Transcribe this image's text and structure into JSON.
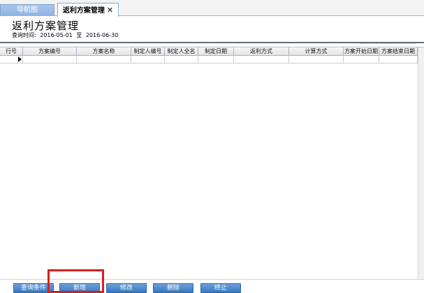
{
  "tabs": [
    {
      "label": "导航图"
    },
    {
      "label": "返利方案管理",
      "close": "✕"
    }
  ],
  "page": {
    "title": "返利方案管理",
    "query_label": "查询时间:",
    "date_from": "2016-05-01",
    "to_word": "至",
    "date_to": "2016-06-30"
  },
  "grid": {
    "columns": [
      "行号",
      "方案编号",
      "方案名称",
      "制定人编号",
      "制定人全名",
      "制定日期",
      "返利方式",
      "计算方式",
      "方案开始日期",
      "方案结束日期"
    ]
  },
  "buttons": {
    "query": "查询条件",
    "add": "新增",
    "edit": "修改",
    "delete": "删除",
    "stop": "终止"
  }
}
